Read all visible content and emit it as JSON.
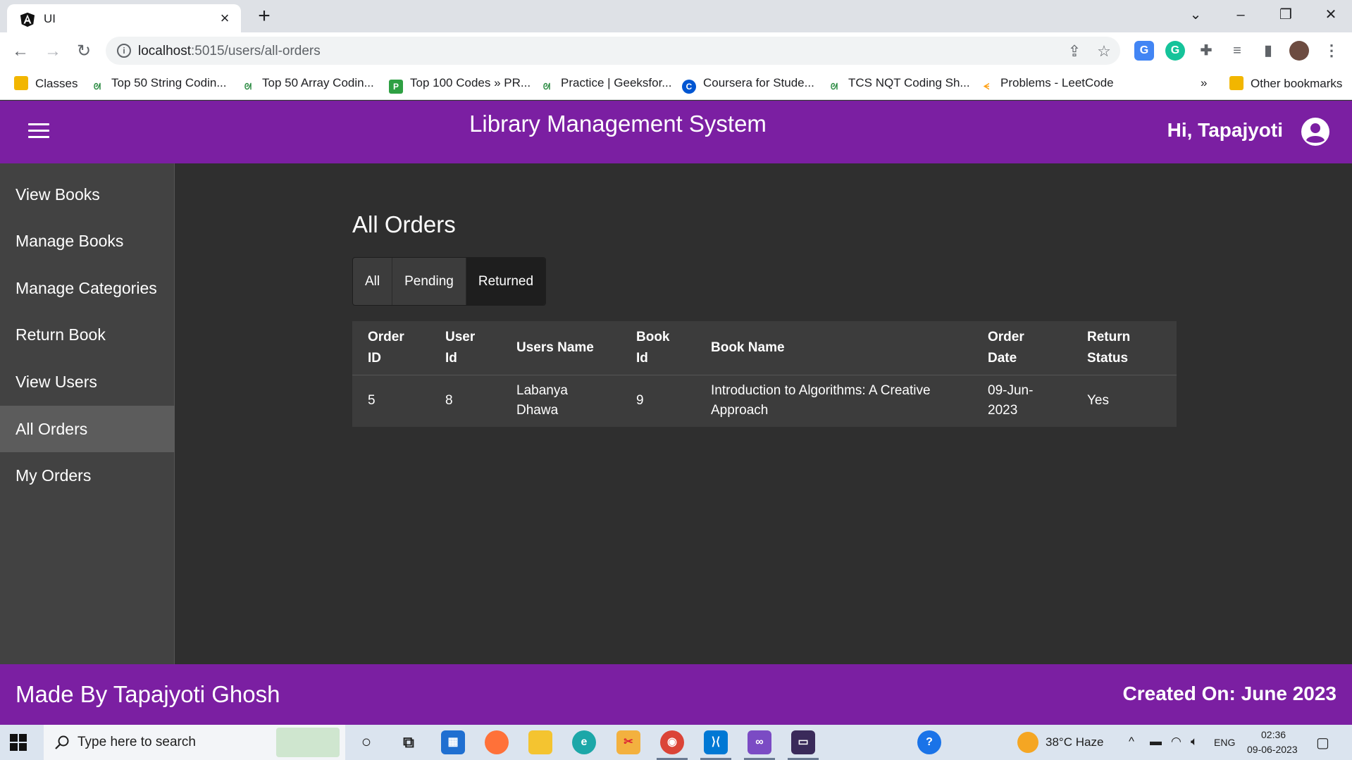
{
  "browser": {
    "tab_title": "UI",
    "url_host": "localhost",
    "url_path": ":5015/users/all-orders",
    "bookmarks": [
      {
        "label": "Classes",
        "icon": "folder-icon",
        "color": "#f2b600"
      },
      {
        "label": "Top 50 String Codin...",
        "icon": "geeksforgeeks-icon",
        "color": "#2f8d46"
      },
      {
        "label": "Top 50 Array Codin...",
        "icon": "geeksforgeeks-icon",
        "color": "#2f8d46"
      },
      {
        "label": "Top 100 Codes » PR...",
        "icon": "prepinsta-icon",
        "color": "#2ea043"
      },
      {
        "label": "Practice | Geeksfor...",
        "icon": "geeksforgeeks-icon",
        "color": "#2f8d46"
      },
      {
        "label": "Coursera for Stude...",
        "icon": "coursera-icon",
        "color": "#0056d2"
      },
      {
        "label": "TCS NQT Coding Sh...",
        "icon": "geeksforgeeks-icon",
        "color": "#2f8d46"
      },
      {
        "label": "Problems - LeetCode",
        "icon": "leetcode-icon",
        "color": "#ffa116"
      }
    ],
    "bookmarks_overflow": "»",
    "other_bookmarks": "Other bookmarks"
  },
  "header": {
    "title": "Library Management System",
    "greeting": "Hi, Tapajyoti"
  },
  "sidebar": {
    "items": [
      {
        "label": "View Books",
        "active": false
      },
      {
        "label": "Manage Books",
        "active": false
      },
      {
        "label": "Manage Categories",
        "active": false
      },
      {
        "label": "Return Book",
        "active": false
      },
      {
        "label": "View Users",
        "active": false
      },
      {
        "label": "All Orders",
        "active": true
      },
      {
        "label": "My Orders",
        "active": false
      }
    ]
  },
  "main": {
    "page_title": "All Orders",
    "tabs": [
      {
        "label": "All",
        "selected": false
      },
      {
        "label": "Pending",
        "selected": false
      },
      {
        "label": "Returned",
        "selected": true
      }
    ],
    "table": {
      "columns": [
        "Order ID",
        "User Id",
        "Users Name",
        "Book Id",
        "Book Name",
        "Order Date",
        "Return Status"
      ],
      "rows": [
        [
          "5",
          "8",
          "Labanya Dhawa",
          "9",
          "Introduction to Algorithms: A Creative Approach",
          "09-Jun-2023",
          "Yes"
        ]
      ]
    }
  },
  "footer": {
    "left": "Made By Tapajyoti Ghosh",
    "right": "Created On: June 2023"
  },
  "taskbar": {
    "search_placeholder": "Type here to search",
    "weather": "38°C  Haze",
    "language": "ENG",
    "time": "02:36",
    "date": "09-06-2023"
  },
  "colors": {
    "brand": "#7b1fa2",
    "content_bg": "#2f2f2f",
    "sidebar_bg": "#424242"
  }
}
